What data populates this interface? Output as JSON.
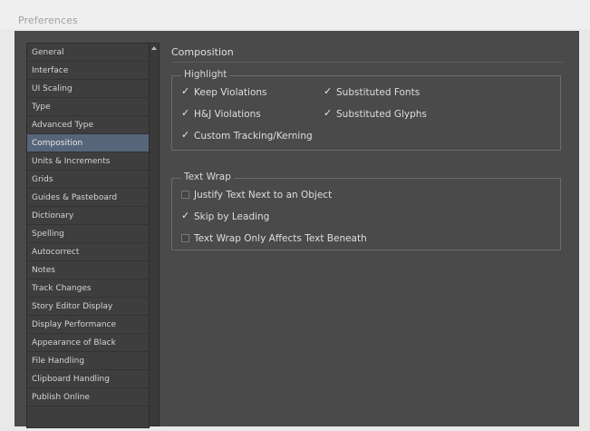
{
  "window": {
    "title": "Preferences"
  },
  "sidebar": {
    "items": [
      {
        "label": "General",
        "selected": false
      },
      {
        "label": "Interface",
        "selected": false
      },
      {
        "label": "UI Scaling",
        "selected": false
      },
      {
        "label": "Type",
        "selected": false
      },
      {
        "label": "Advanced Type",
        "selected": false
      },
      {
        "label": "Composition",
        "selected": true
      },
      {
        "label": "Units & Increments",
        "selected": false
      },
      {
        "label": "Grids",
        "selected": false
      },
      {
        "label": "Guides & Pasteboard",
        "selected": false
      },
      {
        "label": "Dictionary",
        "selected": false
      },
      {
        "label": "Spelling",
        "selected": false
      },
      {
        "label": "Autocorrect",
        "selected": false
      },
      {
        "label": "Notes",
        "selected": false
      },
      {
        "label": "Track Changes",
        "selected": false
      },
      {
        "label": "Story Editor Display",
        "selected": false
      },
      {
        "label": "Display Performance",
        "selected": false
      },
      {
        "label": "Appearance of Black",
        "selected": false
      },
      {
        "label": "File Handling",
        "selected": false
      },
      {
        "label": "Clipboard Handling",
        "selected": false
      },
      {
        "label": "Publish Online",
        "selected": false
      }
    ]
  },
  "main": {
    "section_title": "Composition",
    "highlight": {
      "label": "Highlight",
      "keep_violations": {
        "label": "Keep Violations",
        "checked": true
      },
      "hj_violations": {
        "label": "H&J Violations",
        "checked": true
      },
      "custom_tracking": {
        "label": "Custom Tracking/Kerning",
        "checked": true
      },
      "substituted_fonts": {
        "label": "Substituted Fonts",
        "checked": true
      },
      "substituted_glyphs": {
        "label": "Substituted Glyphs",
        "checked": true
      }
    },
    "text_wrap": {
      "label": "Text Wrap",
      "justify_next": {
        "label": "Justify Text Next to an Object",
        "checked": false
      },
      "skip_by_leading": {
        "label": "Skip by Leading",
        "checked": true
      },
      "affects_beneath": {
        "label": "Text Wrap Only Affects Text Beneath",
        "checked": false
      }
    }
  },
  "colors": {
    "panel_bg": "#4a4a4a",
    "selected_item": "#56657a"
  }
}
